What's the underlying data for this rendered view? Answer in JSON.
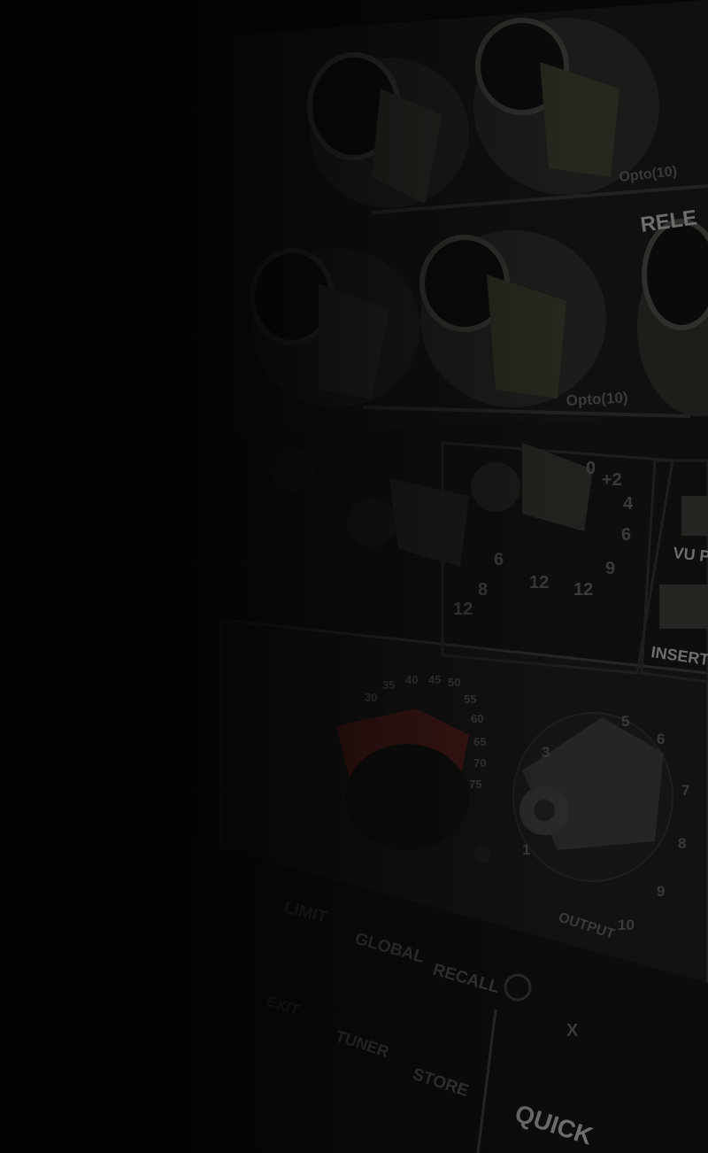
{
  "photo": {
    "labels": {
      "opto_upper": "Opto(10)",
      "release": "RELE",
      "opto_lower": "Opto(10)",
      "vu_pre": "VU PR",
      "insert": "INSERT",
      "output": "OUTPUT",
      "limit": "LIMIT",
      "global": "GLOBAL",
      "recall": "RECALL",
      "tuner": "TUNER",
      "store": "STORE",
      "exit": "EXIT",
      "x_key": "X",
      "quick": "QUICK"
    },
    "scale_output": [
      "1",
      "3",
      "5",
      "6",
      "7",
      "8",
      "9",
      "10"
    ],
    "scale_gain": [
      "30",
      "35",
      "40",
      "45",
      "50",
      "55",
      "60",
      "65",
      "70",
      "75"
    ],
    "scale_threshold": [
      "0",
      "+2",
      "4",
      "6",
      "9",
      "12",
      "12",
      "8",
      "12",
      "6"
    ]
  },
  "colors": {
    "panel": "#141414",
    "knob_cream": "#2b2a27",
    "red_knob": "#3a1614",
    "dark_overlay": "#050505"
  }
}
